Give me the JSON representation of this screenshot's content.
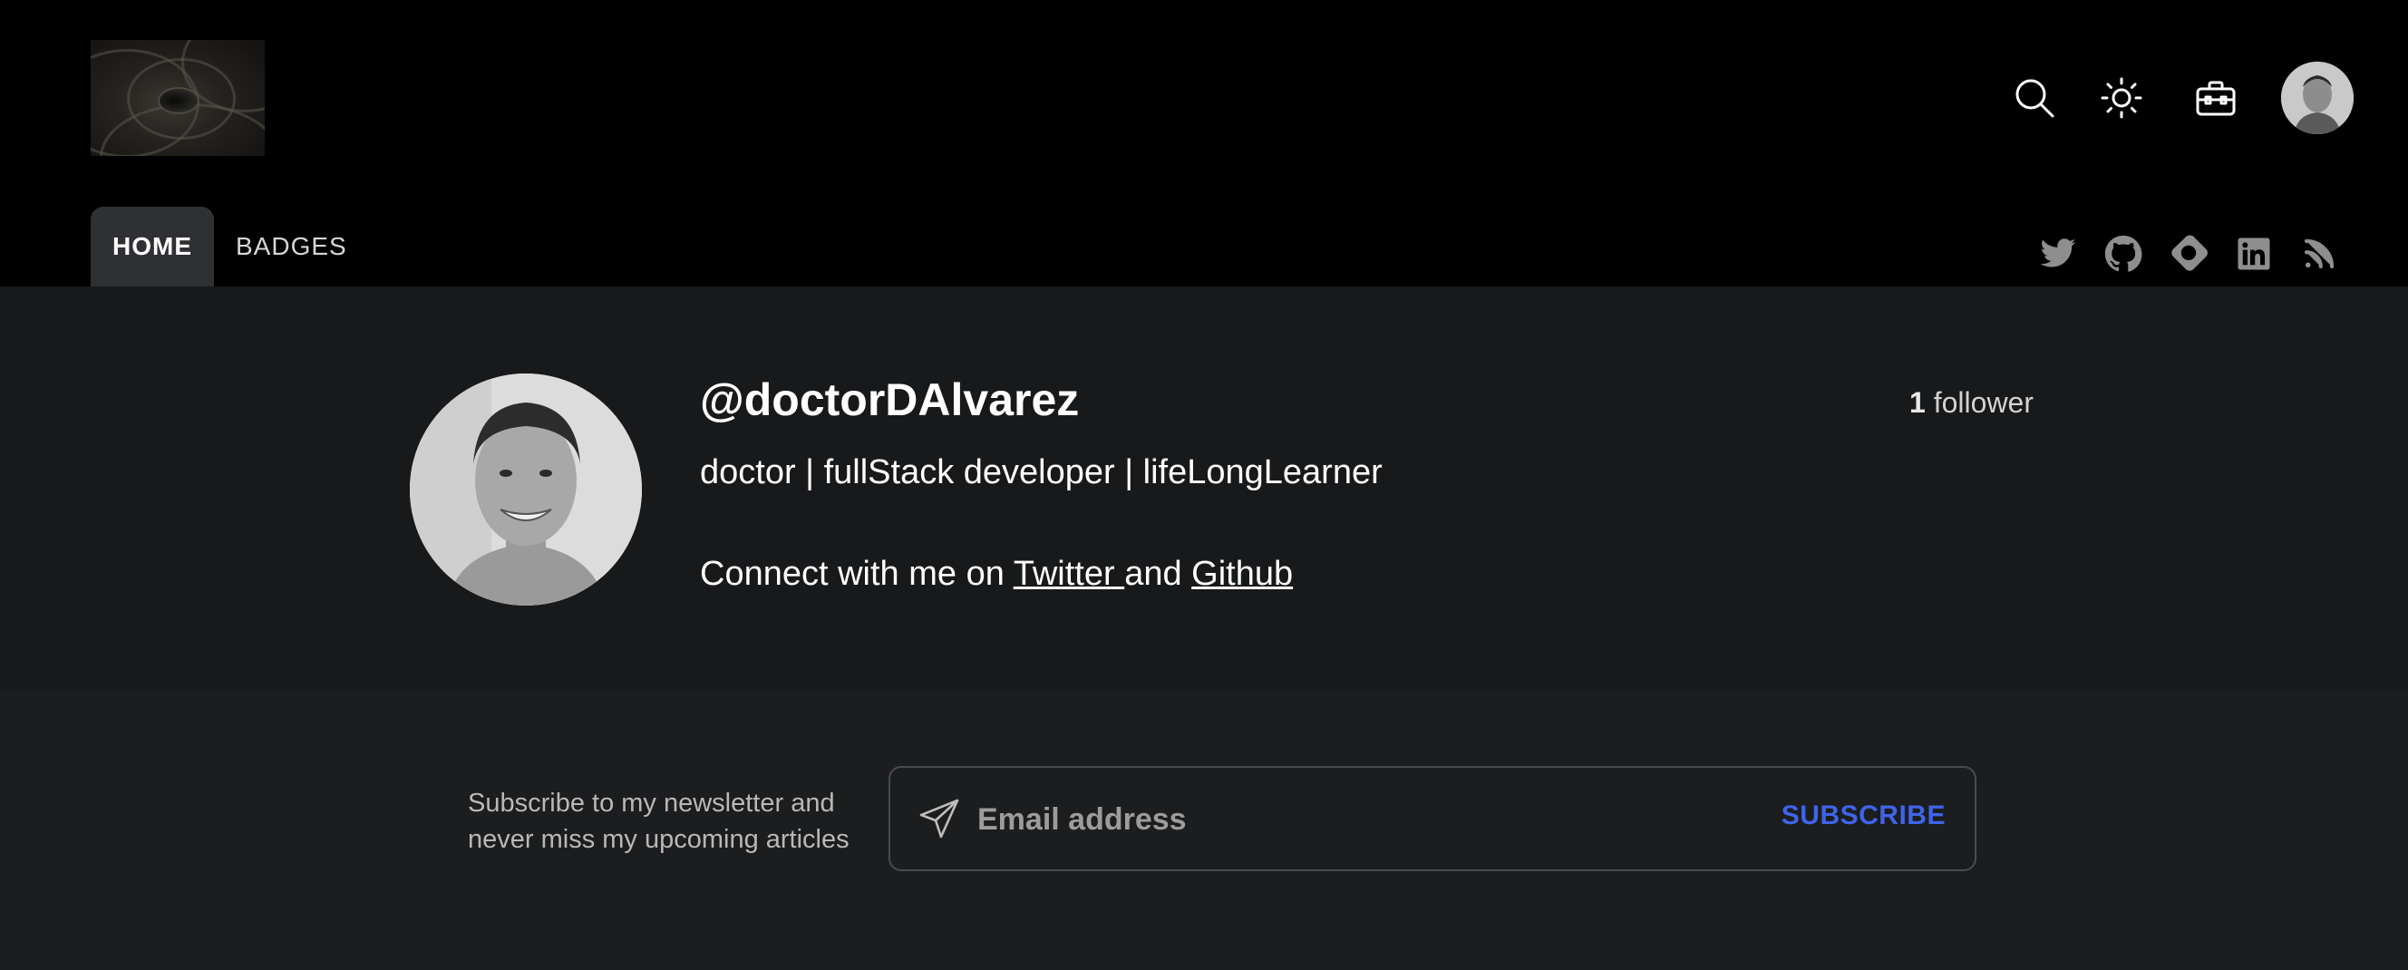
{
  "header": {
    "logo_alt": "blog logo",
    "icons": [
      "search-icon",
      "sun-icon",
      "toolbox-icon"
    ],
    "tabs": [
      {
        "label": "HOME",
        "active": true
      },
      {
        "label": "BADGES",
        "active": false
      }
    ],
    "socials": [
      "twitter-icon",
      "github-icon",
      "hashnode-icon",
      "linkedin-icon",
      "rss-icon"
    ]
  },
  "profile": {
    "handle": "@doctorDAlvarez",
    "followers_count": "1",
    "followers_label": " follower",
    "tagline": "doctor | fullStack developer | lifeLongLearner",
    "connect_prefix": "Connect with me on ",
    "twitter_link": "Twitter ",
    "connect_and": "and ",
    "github_link": "Github"
  },
  "newsletter": {
    "text": "Subscribe to my newsletter and never miss my upcoming articles",
    "email_placeholder": "Email address",
    "email_value": "",
    "subscribe_label": "SUBSCRIBE"
  },
  "colors": {
    "header_bg": "#000000",
    "page_bg": "#18191b",
    "accent": "#3e64e8",
    "active_tab_bg": "#2f3033"
  }
}
